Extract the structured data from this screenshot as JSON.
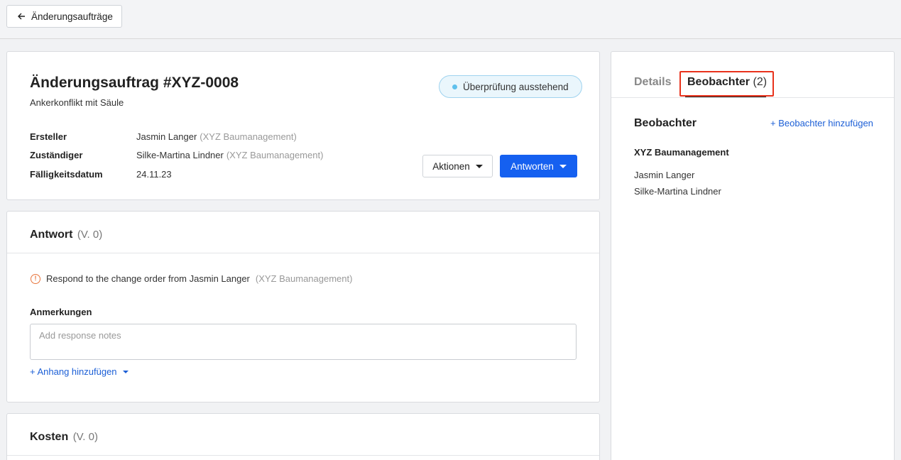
{
  "topbar": {
    "back_label": "Änderungsaufträge"
  },
  "header": {
    "title": "Änderungsauftrag #XYZ-0008",
    "subtitle": "Ankerkonflikt mit Säule",
    "status": "Überprüfung ausstehend",
    "fields": [
      {
        "label": "Ersteller",
        "value": "Jasmin Langer",
        "org": "(XYZ Baumanagement)"
      },
      {
        "label": "Zuständiger",
        "value": "Silke-Martina Lindner",
        "org": "(XYZ Baumanagement)"
      },
      {
        "label": "Fälligkeitsdatum",
        "value": "24.11.23",
        "org": ""
      }
    ],
    "actions_label": "Aktionen",
    "reply_label": "Antworten"
  },
  "response": {
    "title": "Antwort",
    "version": "(V. 0)",
    "notice_text": "Respond to the change order from Jasmin Langer",
    "notice_org": "(XYZ Baumanagement)",
    "notes_label": "Anmerkungen",
    "notes_placeholder": "Add response notes",
    "notes_value": "",
    "attach_label": "+ Anhang hinzufügen"
  },
  "costs": {
    "title": "Kosten",
    "version": "(V. 0)"
  },
  "sidebar": {
    "tabs": [
      {
        "label": "Details"
      },
      {
        "label": "Beobachter",
        "count": "(2)"
      }
    ],
    "heading": "Beobachter",
    "add_label": "+ Beobachter hinzufügen",
    "org": "XYZ Baumanagement",
    "watchers": [
      "Jasmin Langer",
      "Silke-Martina Lindner"
    ]
  },
  "colors": {
    "primary": "#1560f0",
    "link": "#1c5fd6",
    "status_dot": "#5fc0ec",
    "highlight": "#e8321c",
    "warning": "#e8743b"
  }
}
